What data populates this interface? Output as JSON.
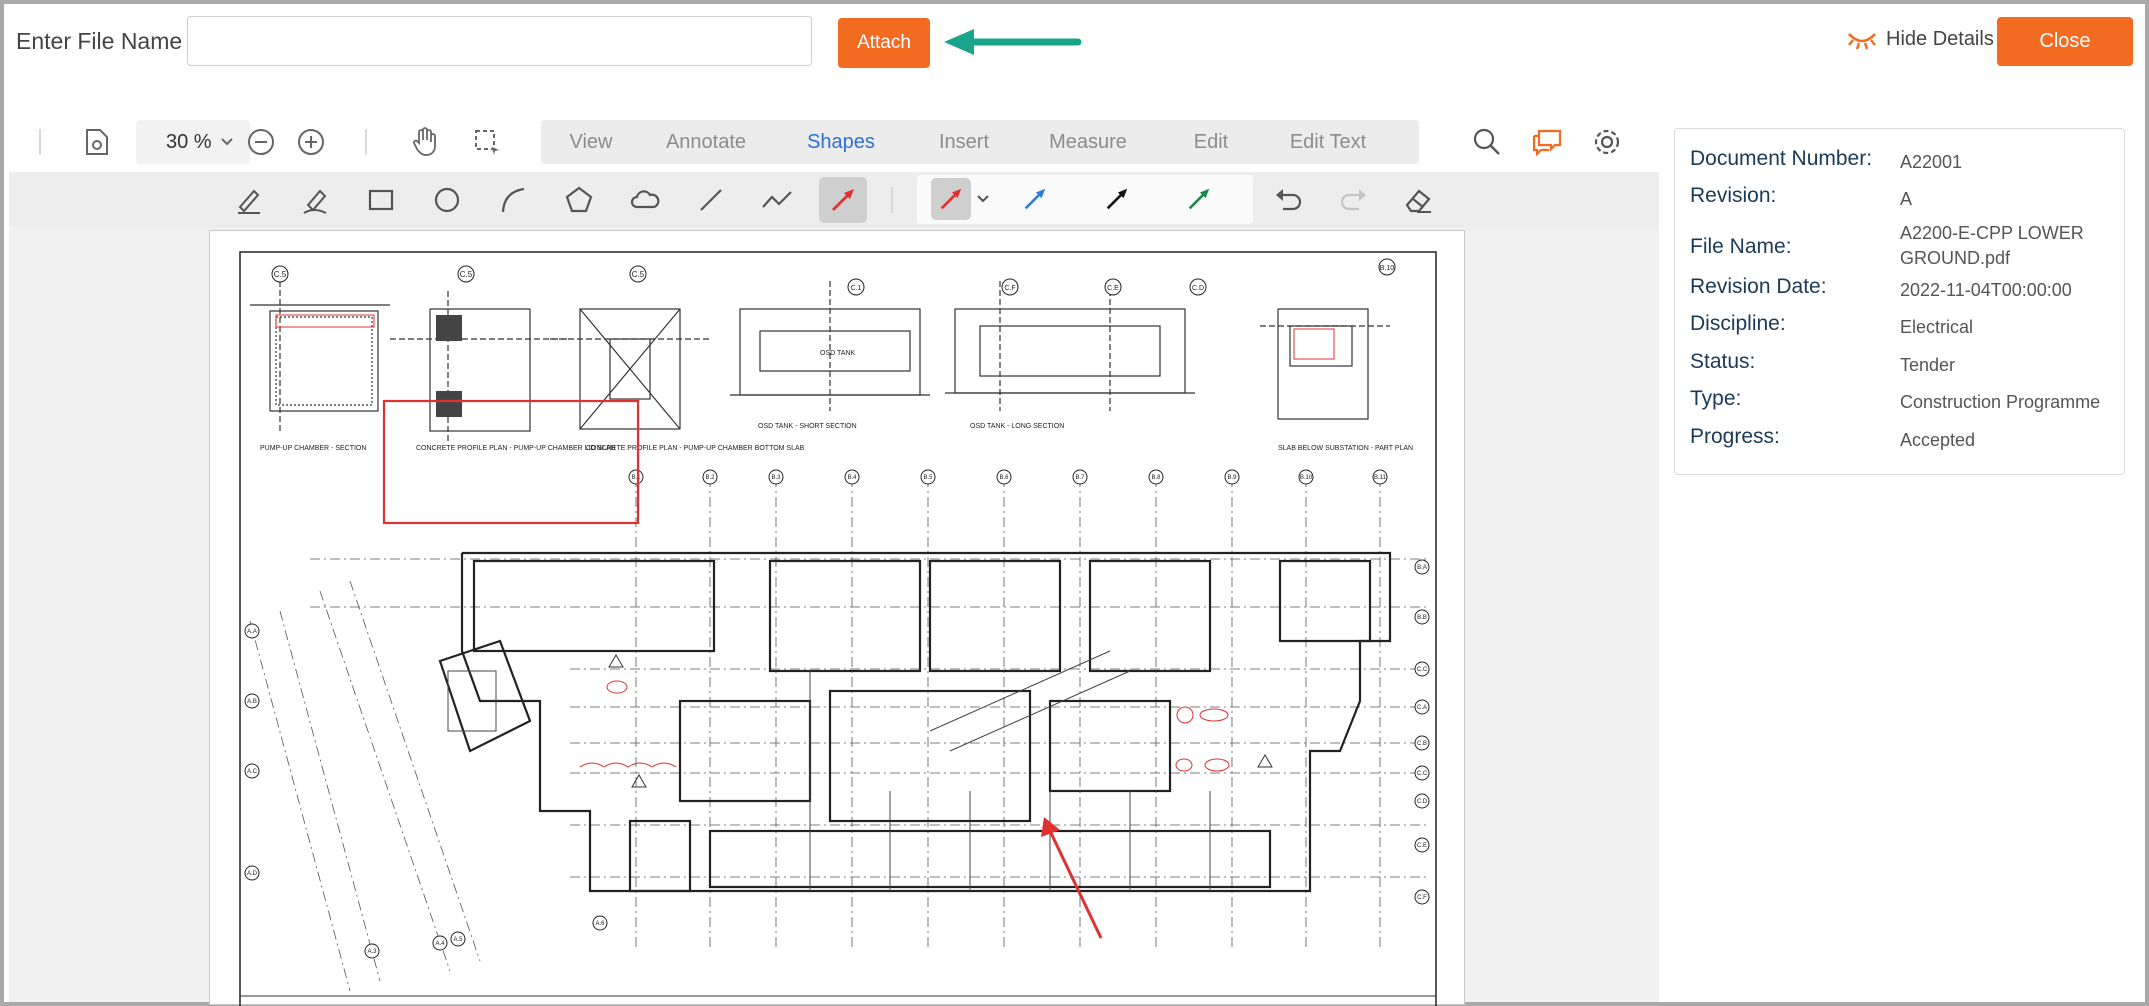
{
  "header": {
    "file_name_label": "Enter File Name",
    "file_name_value": "",
    "attach_label": "Attach",
    "hide_details_label": "Hide Details",
    "close_label": "Close"
  },
  "toolbar": {
    "zoom_value": "30 %",
    "tabs": [
      {
        "label": "View",
        "active": false
      },
      {
        "label": "Annotate",
        "active": false
      },
      {
        "label": "Shapes",
        "active": true
      },
      {
        "label": "Insert",
        "active": false
      },
      {
        "label": "Measure",
        "active": false
      },
      {
        "label": "Edit",
        "active": false
      },
      {
        "label": "Edit Text",
        "active": false
      }
    ],
    "shape_tools": [
      "pen-icon",
      "highlighter-icon",
      "rectangle-icon",
      "ellipse-icon",
      "arc-icon",
      "polygon-icon",
      "cloud-icon",
      "line-icon",
      "polyline-icon",
      "arrow-icon"
    ],
    "arrow_colors": [
      "#e03131",
      "#2f7fd6",
      "#111111",
      "#1a8a4a"
    ],
    "accent_color": "#f26b21",
    "active_tab_color": "#2f6fd6"
  },
  "details": {
    "rows": [
      {
        "label": "Document Number:",
        "value": "A22001"
      },
      {
        "label": "Revision:",
        "value": "A"
      },
      {
        "label": "File Name:",
        "value": "A2200-E-CPP LOWER GROUND.pdf"
      },
      {
        "label": "Revision Date:",
        "value": "2022-11-04T00:00:00"
      },
      {
        "label": "Discipline:",
        "value": "Electrical"
      },
      {
        "label": "Status:",
        "value": "Tender"
      },
      {
        "label": "Type:",
        "value": "Construction Programme"
      },
      {
        "label": "Progress:",
        "value": "Accepted"
      }
    ]
  },
  "drawing": {
    "titles": [
      "PUMP-UP CHAMBER - SECTION",
      "CONCRETE PROFILE PLAN - PUMP-UP CHAMBER LID SLAB",
      "CONCRETE PROFILE PLAN - PUMP-UP CHAMBER BOTTOM SLAB",
      "OSD TANK - SHORT SECTION",
      "OSD TANK - LONG SECTION",
      "SLAB BELOW SUBSTATION - PART PLAN"
    ],
    "top_grid": [
      "B.1",
      "B.2",
      "B.3",
      "B.4",
      "B.5",
      "B.6",
      "B.7",
      "B.8",
      "B.9",
      "B.10",
      "B.11"
    ],
    "right_grid": [
      "B.A",
      "B.B",
      "C.C",
      "C.A",
      "C.B",
      "C.C",
      "C.D",
      "C.E",
      "C.F"
    ],
    "left_grid": [
      "A.A",
      "A.B",
      "A.C",
      "A.D"
    ],
    "bottom_grid": [
      "A.3",
      "A.4",
      "A.5",
      "A.6"
    ],
    "detail_tags": [
      "C.5",
      "C.5",
      "C.5",
      "C.1",
      "C.F",
      "C.E",
      "C.D",
      "B.10"
    ],
    "label_osd": "OSD TANK"
  }
}
